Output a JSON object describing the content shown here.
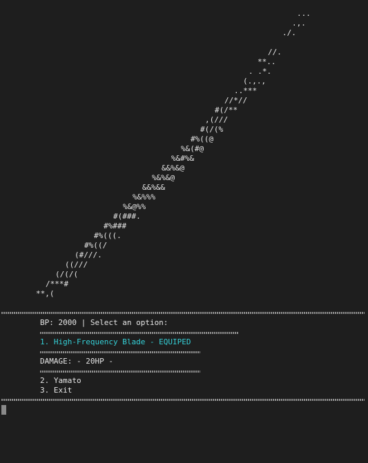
{
  "theme": {
    "background": "#1e1e1e",
    "foreground": "#e6e6e6",
    "accent": "#35d0d7"
  },
  "ascii_art": {
    "lines": [
      "...",
      ".,.",
      "./.",
      "//.",
      "**..",
      ". .*.",
      "(.,.,",
      "..***",
      "//*//",
      "#(/**",
      ",(///",
      "#(/(%",
      "#%((@",
      "%&(#@",
      "%&#%&",
      "&&%&@",
      "%&%&@",
      "&&%&&",
      "%&%%%",
      "%&@%%",
      "#(###.",
      "#%###",
      "#%(((.",
      "#%((/",
      "(#///.",
      "((///",
      "(/(/(",
      "/***#",
      "**,("
    ]
  },
  "menu": {
    "bp_prompt": "BP: 2000 | Select an option:",
    "selected_item": "1. High-Frequency Blade - EQUIPED",
    "damage_label": "DAMAGE: - 20HP -",
    "item_2": "2. Yamato",
    "item_3": "3. Exit"
  }
}
